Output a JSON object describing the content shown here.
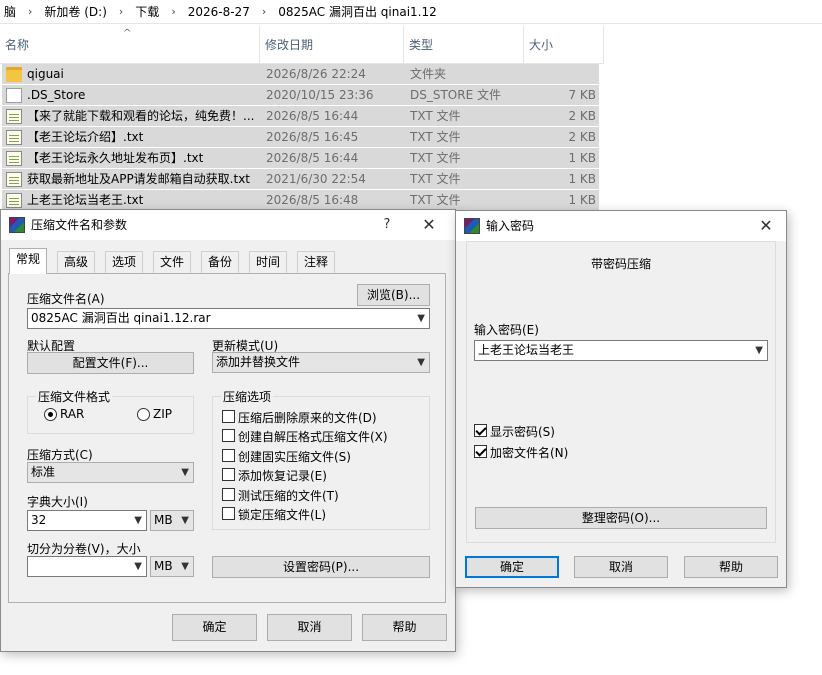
{
  "explorer": {
    "breadcrumb": [
      "脑",
      "新加卷 (D:)",
      "下载",
      "2026-8-27",
      "0825AC 漏洞百出 qinai1.12"
    ],
    "columns": {
      "name": "名称",
      "modified": "修改日期",
      "type": "类型",
      "size": "大小"
    },
    "files": [
      {
        "name": "qiguai",
        "date": "2026/8/26 22:24",
        "type": "文件夹",
        "size": "",
        "icon": "folder-icon"
      },
      {
        "name": ".DS_Store",
        "date": "2020/10/15 23:36",
        "type": "DS_STORE 文件",
        "size": "7 KB",
        "icon": "file-icon"
      },
      {
        "name": "【来了就能下载和观看的论坛，纯免费！...",
        "date": "2026/8/5 16:44",
        "type": "TXT 文件",
        "size": "2 KB",
        "icon": "text-file-icon"
      },
      {
        "name": "【老王论坛介绍】.txt",
        "date": "2026/8/5 16:45",
        "type": "TXT 文件",
        "size": "2 KB",
        "icon": "text-file-icon"
      },
      {
        "name": "【老王论坛永久地址发布页】.txt",
        "date": "2026/8/5 16:44",
        "type": "TXT 文件",
        "size": "1 KB",
        "icon": "text-file-icon"
      },
      {
        "name": "获取最新地址及APP请发邮箱自动获取.txt",
        "date": "2021/6/30 22:54",
        "type": "TXT 文件",
        "size": "1 KB",
        "icon": "text-file-icon"
      },
      {
        "name": "上老王论坛当老王.txt",
        "date": "2026/8/5 16:48",
        "type": "TXT 文件",
        "size": "1 KB",
        "icon": "text-file-icon"
      }
    ]
  },
  "archive_dialog": {
    "title": "压缩文件名和参数",
    "help_glyph": "?",
    "close_glyph": "✕",
    "tabs": [
      "常规",
      "高级",
      "选项",
      "文件",
      "备份",
      "时间",
      "注释"
    ],
    "archive_name_label": "压缩文件名(A)",
    "browse_label": "浏览(B)...",
    "archive_name_value": "0825AC 漏洞百出 qinai1.12.rar",
    "default_profile_label": "默认配置",
    "profiles_button": "配置文件(F)...",
    "update_mode_label": "更新模式(U)",
    "update_mode_value": "添加并替换文件",
    "format_group": "压缩文件格式",
    "format_rar": "RAR",
    "format_zip": "ZIP",
    "method_label": "压缩方式(C)",
    "method_value": "标准",
    "dict_label": "字典大小(I)",
    "dict_value": "32",
    "dict_unit": "MB",
    "split_label": "切分为分卷(V)，大小",
    "split_value": "",
    "split_unit": "MB",
    "options_group": "压缩选项",
    "options": [
      "压缩后删除原来的文件(D)",
      "创建自解压格式压缩文件(X)",
      "创建固实压缩文件(S)",
      "添加恢复记录(E)",
      "测试压缩的文件(T)",
      "锁定压缩文件(L)"
    ],
    "set_password_button": "设置密码(P)...",
    "ok": "确定",
    "cancel": "取消",
    "help": "帮助"
  },
  "password_dialog": {
    "title": "输入密码",
    "close_glyph": "✕",
    "heading": "带密码压缩",
    "password_label": "输入密码(E)",
    "password_value": "上老王论坛当老王",
    "show_password": "显示密码(S)",
    "encrypt_names": "加密文件名(N)",
    "organize_button": "整理密码(O)...",
    "ok": "确定",
    "cancel": "取消",
    "help": "帮助"
  }
}
